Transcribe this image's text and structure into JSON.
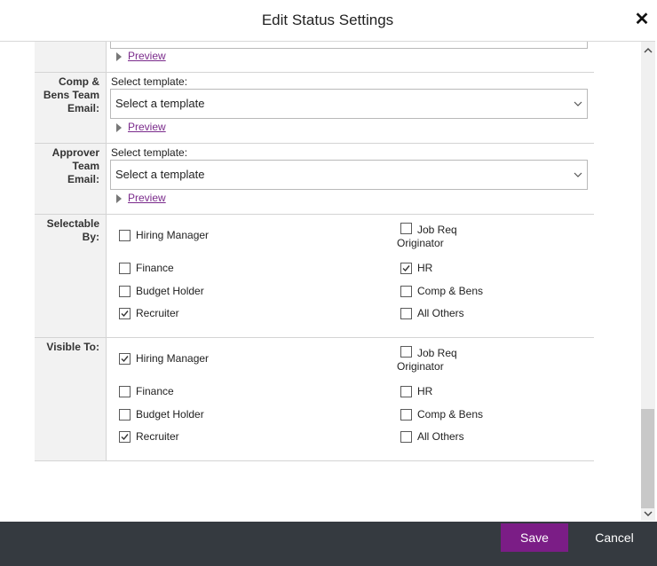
{
  "header": {
    "title": "Edit Status Settings",
    "close_icon": "close-icon"
  },
  "sections": {
    "top_preview": {
      "preview_label": "Preview"
    },
    "comp_bens": {
      "label_line1": "Comp &",
      "label_line2": "Bens Team",
      "label_line3": "Email:",
      "select_label": "Select template:",
      "select_value": "Select a template",
      "preview_label": "Preview"
    },
    "approver": {
      "label_line1": "Approver",
      "label_line2": "Team",
      "label_line3": "Email:",
      "select_label": "Select template:",
      "select_value": "Select a template",
      "preview_label": "Preview"
    },
    "selectable_by": {
      "label_line1": "Selectable",
      "label_line2": "By:",
      "items": [
        {
          "label": "Hiring Manager",
          "checked": false
        },
        {
          "label_line1": "Job Req",
          "label_line2": "Originator",
          "checked": false
        },
        {
          "label": "Finance",
          "checked": false
        },
        {
          "label": "HR",
          "checked": true
        },
        {
          "label": "Budget Holder",
          "checked": false
        },
        {
          "label": "Comp & Bens",
          "checked": false
        },
        {
          "label": "Recruiter",
          "checked": true
        },
        {
          "label": "All Others",
          "checked": false
        }
      ]
    },
    "visible_to": {
      "label": "Visible To:",
      "items": [
        {
          "label": "Hiring Manager",
          "checked": true
        },
        {
          "label_line1": "Job Req",
          "label_line2": "Originator",
          "checked": false
        },
        {
          "label": "Finance",
          "checked": false
        },
        {
          "label": "HR",
          "checked": false
        },
        {
          "label": "Budget Holder",
          "checked": false
        },
        {
          "label": "Comp & Bens",
          "checked": false
        },
        {
          "label": "Recruiter",
          "checked": true
        },
        {
          "label": "All Others",
          "checked": false
        }
      ]
    }
  },
  "footer": {
    "save_label": "Save",
    "cancel_label": "Cancel"
  },
  "colors": {
    "save_button": "#7b1d86",
    "footer_bg": "#353a40",
    "link": "#7a2a8b"
  }
}
